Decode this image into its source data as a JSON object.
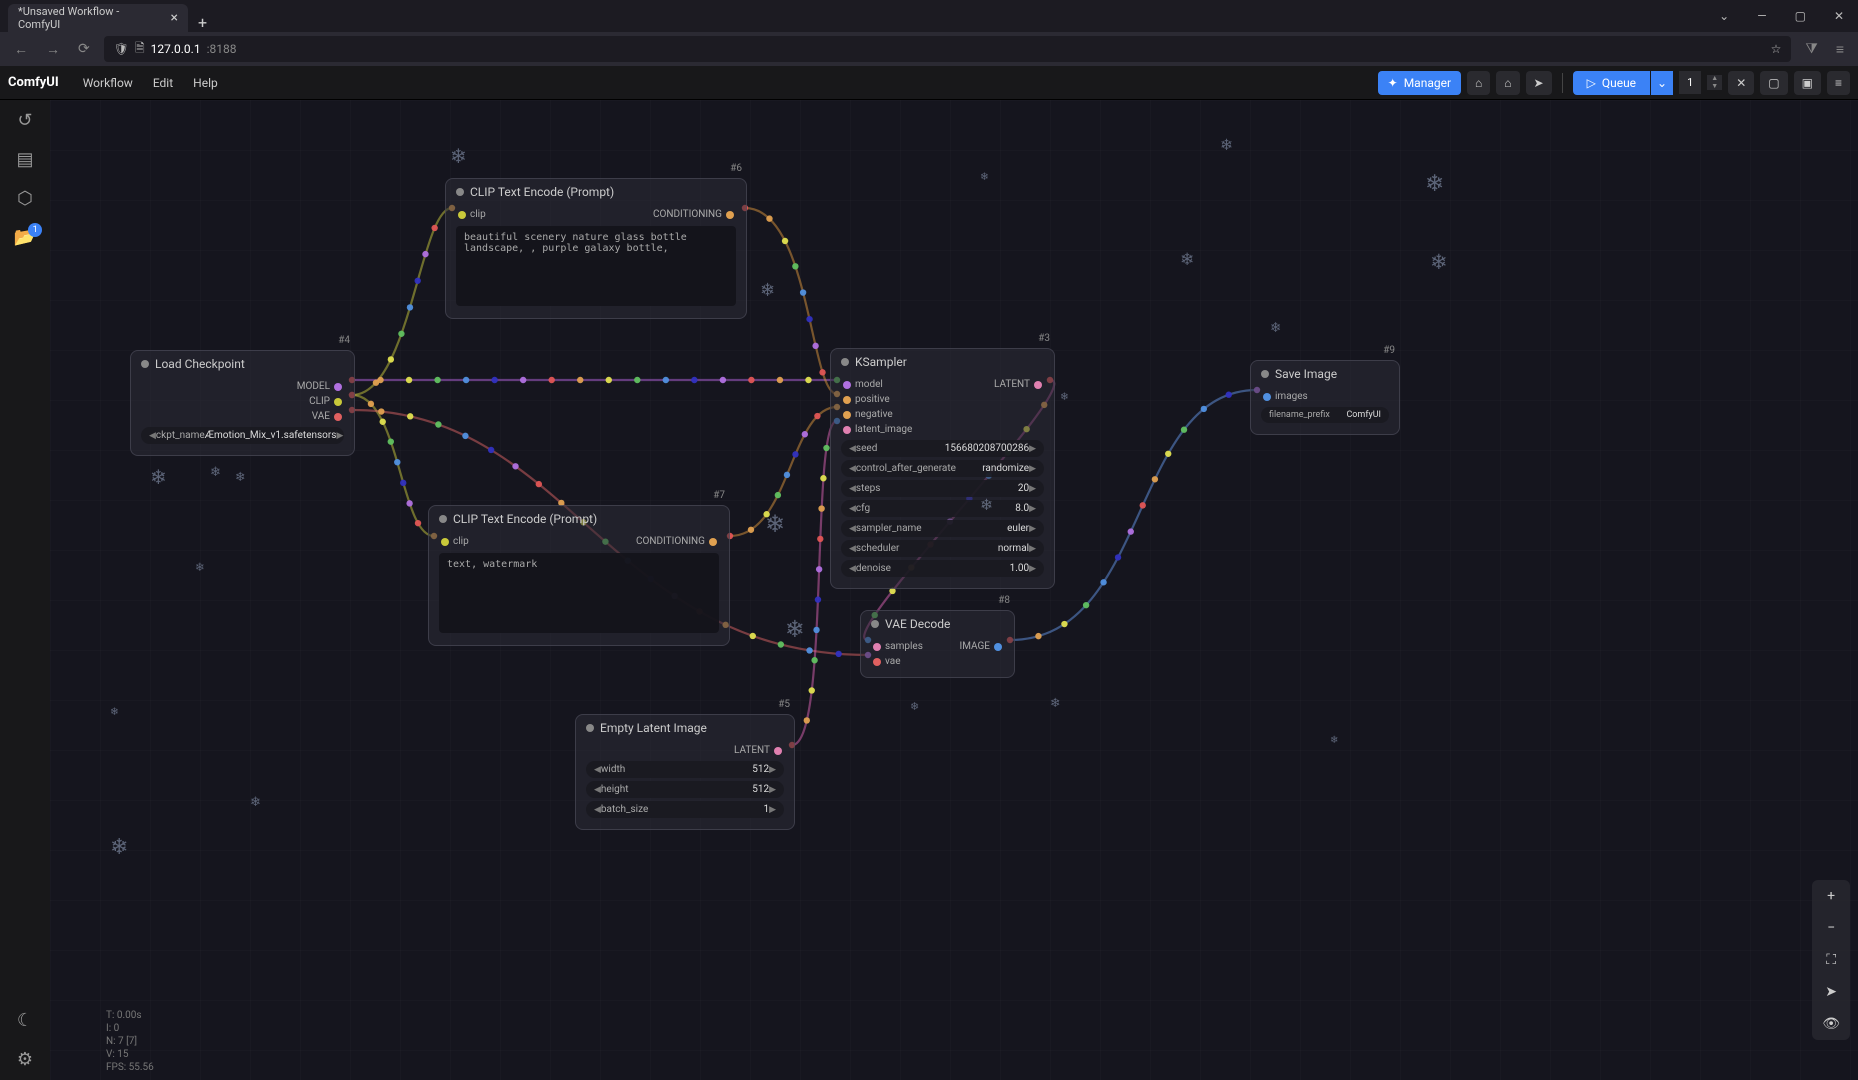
{
  "browser": {
    "tab_title": "*Unsaved Workflow - ComfyUI",
    "url_host": "127.0.0.1",
    "url_port": ":8188"
  },
  "app": {
    "name": "ComfyUI",
    "menu": [
      "Workflow",
      "Edit",
      "Help"
    ],
    "manager": "Manager",
    "queue": "Queue",
    "queue_count": "1"
  },
  "rail_badge": "1",
  "nodes": {
    "load_ckpt": {
      "id": "#4",
      "title": "Load Checkpoint",
      "out_model": "MODEL",
      "out_clip": "CLIP",
      "out_vae": "VAE",
      "ckpt_label": "ckpt_name",
      "ckpt_value": "Æmotion_Mix_v1.safetensors"
    },
    "clip_pos": {
      "id": "#6",
      "title": "CLIP Text Encode (Prompt)",
      "in_clip": "clip",
      "out_cond": "CONDITIONING",
      "text": "beautiful scenery nature glass bottle landscape, , purple galaxy bottle,"
    },
    "clip_neg": {
      "id": "#7",
      "title": "CLIP Text Encode (Prompt)",
      "in_clip": "clip",
      "out_cond": "CONDITIONING",
      "text": "text, watermark"
    },
    "empty": {
      "id": "#5",
      "title": "Empty Latent Image",
      "out_latent": "LATENT",
      "width_l": "width",
      "width_v": "512",
      "height_l": "height",
      "height_v": "512",
      "batch_l": "batch_size",
      "batch_v": "1"
    },
    "ksampler": {
      "id": "#3",
      "title": "KSampler",
      "in_model": "model",
      "in_pos": "positive",
      "in_neg": "negative",
      "in_lat": "latent_image",
      "out_lat": "LATENT",
      "seed_l": "seed",
      "seed_v": "156680208700286",
      "cag_l": "control_after_generate",
      "cag_v": "randomize",
      "steps_l": "steps",
      "steps_v": "20",
      "cfg_l": "cfg",
      "cfg_v": "8.0",
      "sampler_l": "sampler_name",
      "sampler_v": "euler",
      "sched_l": "scheduler",
      "sched_v": "normal",
      "denoise_l": "denoise",
      "denoise_v": "1.00"
    },
    "vae": {
      "id": "#8",
      "title": "VAE Decode",
      "in_samples": "samples",
      "in_vae": "vae",
      "out_image": "IMAGE"
    },
    "save": {
      "id": "#9",
      "title": "Save Image",
      "in_images": "images",
      "prefix_l": "filename_prefix",
      "prefix_v": "ComfyUI"
    }
  },
  "stats": {
    "t": "T: 0.00s",
    "i": "I: 0",
    "n": "N: 7 [7]",
    "v": "V: 15",
    "fps": "FPS: 55.56"
  }
}
